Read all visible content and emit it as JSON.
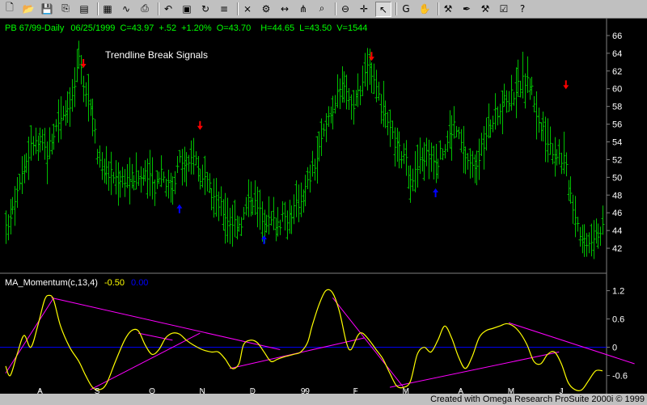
{
  "toolbar": {
    "icons": [
      "new-icon",
      "open-icon",
      "save-icon",
      "copy-icon",
      "print-layout-icon",
      "chart-window-icon",
      "chart-pattern-icon",
      "print-icon",
      "back-icon",
      "format-window-icon",
      "refresh-icon",
      "insert-indicator-icon",
      "insert-study-icon",
      "insert-strategy-icon",
      "draw-icon",
      "fork-icon",
      "zoom-icon",
      "zoom-out-icon",
      "crosshair-icon",
      "pointer-icon",
      "text-icon",
      "hand-icon",
      "hammer-icon",
      "pen-icon",
      "tools-icon",
      "report-icon",
      "help-icon"
    ],
    "help_label": "?"
  },
  "price_header": {
    "symbol": "PB 67/99-Daily",
    "date": "06/25/1999",
    "close": "C=43.97",
    "change": "+.52",
    "change_pct": "+1.20%",
    "open": "O=43.70",
    "high": "H=44.65",
    "low": "L=43.50",
    "volume": "V=1544"
  },
  "price_title": "Trendline Break Signals",
  "indicator_header": {
    "name": "MA_Momentum(c,13,4)",
    "value": "-0.50",
    "zero": "0.00"
  },
  "footer": "Created with Omega Research ProSuite 2000i © 1999",
  "colors": {
    "background": "#000000",
    "bars": "#00c000",
    "momentum": "#ffff00",
    "trendline": "#ff00ff",
    "zero_line": "#0000ff",
    "sell_arrow": "#ff0000",
    "buy_arrow": "#0000ff",
    "header_text": "#00ff00",
    "axis_text": "#ffffff"
  },
  "chart_data": [
    {
      "type": "ohlc",
      "title": "Trendline Break Signals",
      "ylim": [
        40,
        67
      ],
      "y_ticks": [
        42,
        44,
        46,
        48,
        50,
        52,
        54,
        56,
        58,
        60,
        62,
        64,
        66
      ],
      "x_tick_labels": [
        "A",
        "S",
        "O",
        "N",
        "D",
        "99",
        "F",
        "M",
        "A",
        "M",
        "J"
      ],
      "x_tick_bar_index": [
        15,
        40,
        64,
        86,
        108,
        131,
        153,
        175,
        199,
        221,
        243
      ],
      "bar_count": 262,
      "close_anchors": [
        [
          0,
          44
        ],
        [
          6,
          50
        ],
        [
          12,
          54
        ],
        [
          18,
          53
        ],
        [
          24,
          57
        ],
        [
          27,
          58
        ],
        [
          29,
          59
        ],
        [
          32,
          63
        ],
        [
          34,
          61
        ],
        [
          36,
          59
        ],
        [
          39,
          56
        ],
        [
          40,
          53
        ],
        [
          42,
          51
        ],
        [
          48,
          50
        ],
        [
          54,
          50
        ],
        [
          58,
          50
        ],
        [
          62,
          50
        ],
        [
          65,
          49
        ],
        [
          68,
          51
        ],
        [
          71,
          49
        ],
        [
          73,
          49
        ],
        [
          76,
          52
        ],
        [
          80,
          51
        ],
        [
          82,
          53
        ],
        [
          85,
          50
        ],
        [
          88,
          49
        ],
        [
          93,
          47
        ],
        [
          98,
          45
        ],
        [
          103,
          45
        ],
        [
          107,
          48
        ],
        [
          111,
          46
        ],
        [
          115,
          45
        ],
        [
          120,
          45
        ],
        [
          125,
          46
        ],
        [
          130,
          48
        ],
        [
          133,
          50
        ],
        [
          137,
          53
        ],
        [
          141,
          57
        ],
        [
          145,
          59
        ],
        [
          148,
          61
        ],
        [
          151,
          58
        ],
        [
          155,
          60
        ],
        [
          158,
          63
        ],
        [
          160,
          61
        ],
        [
          164,
          58
        ],
        [
          168,
          55
        ],
        [
          172,
          53
        ],
        [
          176,
          51
        ],
        [
          178,
          50
        ],
        [
          182,
          52
        ],
        [
          185,
          53
        ],
        [
          189,
          52
        ],
        [
          193,
          54
        ],
        [
          196,
          56
        ],
        [
          200,
          53
        ],
        [
          204,
          51
        ],
        [
          208,
          53
        ],
        [
          212,
          56
        ],
        [
          216,
          58
        ],
        [
          220,
          59
        ],
        [
          223,
          60
        ],
        [
          227,
          61
        ],
        [
          230,
          60
        ],
        [
          233,
          56
        ],
        [
          237,
          54
        ],
        [
          240,
          53
        ],
        [
          244,
          52
        ],
        [
          248,
          47
        ],
        [
          252,
          43
        ],
        [
          255,
          43
        ],
        [
          258,
          44
        ],
        [
          261,
          44
        ]
      ],
      "sell_signals": [
        {
          "bar": 34,
          "price": 62.8
        },
        {
          "bar": 85,
          "price": 55.8
        },
        {
          "bar": 160,
          "price": 63.6
        },
        {
          "bar": 245,
          "price": 60.4
        }
      ],
      "buy_signals": [
        {
          "bar": 76,
          "price": 46.5
        },
        {
          "bar": 113,
          "price": 43.0
        },
        {
          "bar": 188,
          "price": 48.3
        }
      ]
    },
    {
      "type": "line",
      "title": "MA_Momentum(c,13,4)",
      "ylim": [
        -0.95,
        1.45
      ],
      "y_ticks": [
        -0.6,
        0,
        0.6,
        1.2
      ],
      "zero_line": 0,
      "series": [
        {
          "name": "MA_Momentum(c,13,4)",
          "points": [
            [
              0,
              -0.4
            ],
            [
              2,
              -0.6
            ],
            [
              5,
              -0.15
            ],
            [
              8,
              0.25
            ],
            [
              11,
              0.0
            ],
            [
              14,
              0.45
            ],
            [
              17,
              1.0
            ],
            [
              19,
              1.1
            ],
            [
              21,
              1.0
            ],
            [
              24,
              0.45
            ],
            [
              28,
              0.0
            ],
            [
              32,
              -0.3
            ],
            [
              35,
              -0.6
            ],
            [
              38,
              -0.85
            ],
            [
              41,
              -0.9
            ],
            [
              44,
              -0.78
            ],
            [
              48,
              -0.3
            ],
            [
              52,
              0.15
            ],
            [
              55,
              0.35
            ],
            [
              58,
              0.35
            ],
            [
              61,
              0.05
            ],
            [
              64,
              -0.15
            ],
            [
              67,
              -0.05
            ],
            [
              70,
              0.2
            ],
            [
              73,
              0.3
            ],
            [
              76,
              0.28
            ],
            [
              79,
              0.15
            ],
            [
              82,
              0.05
            ],
            [
              86,
              -0.05
            ],
            [
              90,
              -0.1
            ],
            [
              93,
              -0.1
            ],
            [
              96,
              -0.25
            ],
            [
              99,
              -0.45
            ],
            [
              102,
              -0.35
            ],
            [
              104,
              0.05
            ],
            [
              107,
              0.15
            ],
            [
              110,
              0.1
            ],
            [
              113,
              -0.1
            ],
            [
              116,
              -0.3
            ],
            [
              119,
              -0.25
            ],
            [
              122,
              -0.2
            ],
            [
              126,
              -0.15
            ],
            [
              129,
              -0.1
            ],
            [
              132,
              0.1
            ],
            [
              134,
              0.45
            ],
            [
              137,
              0.9
            ],
            [
              140,
              1.2
            ],
            [
              143,
              1.15
            ],
            [
              146,
              0.75
            ],
            [
              149,
              0.1
            ],
            [
              151,
              -0.05
            ],
            [
              154,
              0.25
            ],
            [
              156,
              0.3
            ],
            [
              159,
              0.15
            ],
            [
              162,
              -0.05
            ],
            [
              165,
              -0.25
            ],
            [
              168,
              -0.55
            ],
            [
              171,
              -0.82
            ],
            [
              174,
              -0.85
            ],
            [
              177,
              -0.72
            ],
            [
              180,
              -0.15
            ],
            [
              183,
              0.0
            ],
            [
              186,
              -0.1
            ],
            [
              189,
              0.15
            ],
            [
              192,
              0.45
            ],
            [
              195,
              0.2
            ],
            [
              198,
              -0.2
            ],
            [
              201,
              -0.45
            ],
            [
              204,
              -0.2
            ],
            [
              207,
              0.2
            ],
            [
              210,
              0.35
            ],
            [
              213,
              0.4
            ],
            [
              216,
              0.45
            ],
            [
              219,
              0.5
            ],
            [
              222,
              0.45
            ],
            [
              225,
              0.3
            ],
            [
              228,
              0.05
            ],
            [
              231,
              -0.3
            ],
            [
              234,
              -0.35
            ],
            [
              237,
              -0.15
            ],
            [
              240,
              -0.1
            ],
            [
              243,
              -0.35
            ],
            [
              246,
              -0.75
            ],
            [
              249,
              -0.9
            ],
            [
              252,
              -0.9
            ],
            [
              255,
              -0.7
            ],
            [
              258,
              -0.5
            ],
            [
              261,
              -0.5
            ]
          ]
        }
      ],
      "trendlines": [
        {
          "from": [
            0,
            -0.55
          ],
          "to": [
            21,
            1.05
          ]
        },
        {
          "from": [
            20,
            1.05
          ],
          "to": [
            120,
            -0.05
          ]
        },
        {
          "from": [
            37,
            -0.9
          ],
          "to": [
            85,
            0.3
          ]
        },
        {
          "from": [
            58,
            0.3
          ],
          "to": [
            73,
            0.15
          ]
        },
        {
          "from": [
            98,
            -0.45
          ],
          "to": [
            157,
            0.2
          ]
        },
        {
          "from": [
            143,
            1.05
          ],
          "to": [
            174,
            -0.85
          ]
        },
        {
          "from": [
            168,
            -0.85
          ],
          "to": [
            242,
            -0.1
          ]
        },
        {
          "from": [
            220,
            0.52
          ],
          "to": [
            275,
            -0.35
          ]
        }
      ]
    }
  ]
}
